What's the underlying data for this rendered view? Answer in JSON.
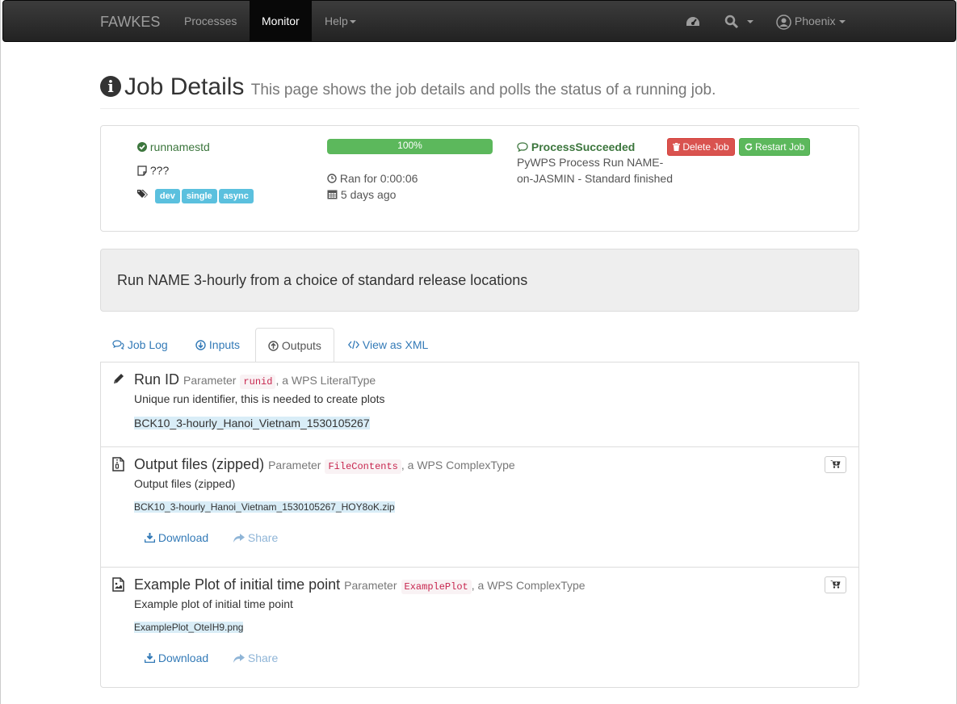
{
  "navbar": {
    "brand": "FAWKES",
    "items": [
      {
        "label": "Processes",
        "active": false
      },
      {
        "label": "Monitor",
        "active": true
      },
      {
        "label": "Help",
        "active": false
      }
    ],
    "user": "Phoenix"
  },
  "header": {
    "title": "Job Details",
    "subtitle": "This page shows the job details and polls the status of a running job."
  },
  "job": {
    "identifier": "runnamestd",
    "caption": "???",
    "tags": [
      "dev",
      "single",
      "async"
    ],
    "progress": "100%",
    "progress_value": 100,
    "duration": "Ran for 0:00:06",
    "created": "5 days ago",
    "status": "ProcessSucceeded",
    "status_message_line1": "PyWPS Process Run NAME-",
    "status_message_line2": "on-JASMIN - Standard finished",
    "delete_label": "Delete Job",
    "restart_label": "Restart Job"
  },
  "abstract": "Run NAME 3-hourly from a choice of standard release locations",
  "tabs": [
    {
      "label": "Job Log",
      "active": false
    },
    {
      "label": "Inputs",
      "active": false
    },
    {
      "label": "Outputs",
      "active": true
    },
    {
      "label": "View as XML",
      "active": false
    }
  ],
  "outputs": [
    {
      "title": "Run ID",
      "param_label": "Parameter",
      "identifier": "runid",
      "type_text": ", a WPS LiteralType",
      "description": "Unique run identifier, this is needed to create plots",
      "value": "BCK10_3-hourly_Hanoi_Vietnam_1530105267"
    },
    {
      "title": "Output files (zipped)",
      "param_label": "Parameter",
      "identifier": "FileContents",
      "type_text": ", a WPS ComplexType",
      "description": "Output files (zipped)",
      "value": "BCK10_3-hourly_Hanoi_Vietnam_1530105267_HOY8oK.zip",
      "download_label": "Download",
      "share_label": "Share"
    },
    {
      "title": "Example Plot of initial time point",
      "param_label": "Parameter",
      "identifier": "ExamplePlot",
      "type_text": ", a WPS ComplexType",
      "description": "Example plot of initial time point",
      "value": "ExamplePlot_OteIH9.png",
      "download_label": "Download",
      "share_label": "Share"
    }
  ]
}
